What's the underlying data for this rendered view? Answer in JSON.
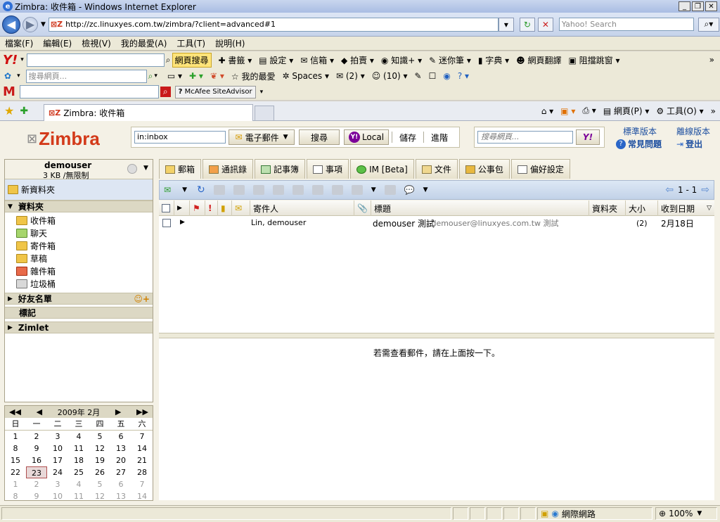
{
  "window": {
    "title": "Zimbra: 收件箱 - Windows Internet Explorer"
  },
  "address": {
    "url": "http://zc.linuxyes.com.tw/zimbra/?client=advanced#1",
    "search_placeholder": "Yahoo! Search"
  },
  "menu": [
    "檔案(F)",
    "編輯(E)",
    "檢視(V)",
    "我的最愛(A)",
    "工具(T)",
    "說明(H)"
  ],
  "yahoo_bar": {
    "search_button": "網頁搜尋",
    "items": [
      "書籤",
      "設定",
      "信箱",
      "拍賣",
      "知識+",
      "迷你筆",
      "字典",
      "網頁翻譯",
      "阻擋跳窗"
    ]
  },
  "msn_bar": {
    "search_placeholder": "搜尋網頁...",
    "items": [
      "我的最愛",
      "Spaces",
      "(2)",
      "(10)"
    ]
  },
  "mcafee": {
    "label": "McAfee SiteAdvisor"
  },
  "ie_tabs": {
    "active_tab": "Zimbra: 收件箱",
    "right_items": [
      "網頁(P)",
      "工具(O)"
    ]
  },
  "zimbra": {
    "brand": "Zimbra",
    "search_value": "in:inbox",
    "search_type": "電子郵件",
    "search_button": "搜尋",
    "local_button": "Local",
    "save_link": "儲存",
    "advanced_link": "進階",
    "web_search_placeholder": "搜尋網頁...",
    "links": {
      "standard": "標準版本",
      "offline": "離線版本",
      "help": "常見問題",
      "logout": "登出"
    },
    "user": {
      "name": "demouser",
      "quota": "3 KB /無限制"
    },
    "new_folder": "新資料夾",
    "folders_header": "資料夾",
    "folders": [
      "收件箱",
      "聊天",
      "寄件箱",
      "草稿",
      "雜件箱",
      "垃圾桶"
    ],
    "buddies_header": "好友名單",
    "tags_header": "標記",
    "zimlet_header": "Zimlet",
    "tabs": [
      "郵箱",
      "通訊錄",
      "記事簿",
      "事項",
      "IM [Beta]",
      "文件",
      "公事包",
      "偏好設定"
    ],
    "pager": "1 - 1",
    "columns": {
      "sender": "寄件人",
      "subject": "標題",
      "folder": "資料夾",
      "size": "大小",
      "date": "收到日期"
    },
    "messages": [
      {
        "sender": "Lin, demouser",
        "subject": "demouser 測試",
        "fragment": "- demouser@linuxyes.com.tw 測試",
        "size": "(2)",
        "date": "2月18日"
      }
    ],
    "preview_hint": "若需查看郵件，請在上面按一下。"
  },
  "calendar": {
    "title": "2009年 2月",
    "weekdays": [
      "日",
      "一",
      "二",
      "三",
      "四",
      "五",
      "六"
    ],
    "weeks": [
      [
        "1",
        "2",
        "3",
        "4",
        "5",
        "6",
        "7"
      ],
      [
        "8",
        "9",
        "10",
        "11",
        "12",
        "13",
        "14"
      ],
      [
        "15",
        "16",
        "17",
        "18",
        "19",
        "20",
        "21"
      ],
      [
        "22",
        "23",
        "24",
        "25",
        "26",
        "27",
        "28"
      ],
      [
        "1",
        "2",
        "3",
        "4",
        "5",
        "6",
        "7"
      ],
      [
        "8",
        "9",
        "10",
        "11",
        "12",
        "13",
        "14"
      ]
    ],
    "today": "23"
  },
  "status": {
    "zone": "網際網路",
    "zoom": "100%"
  }
}
